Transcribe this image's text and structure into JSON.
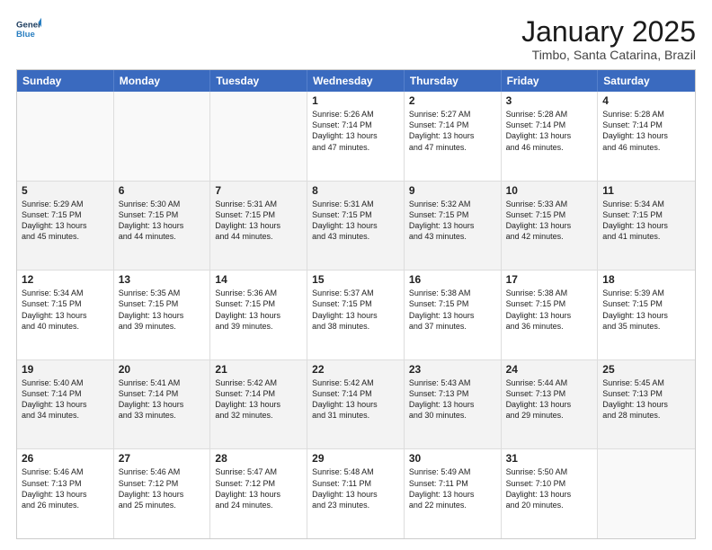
{
  "logo": {
    "line1": "General",
    "line2": "Blue"
  },
  "title": "January 2025",
  "subtitle": "Timbo, Santa Catarina, Brazil",
  "days_of_week": [
    "Sunday",
    "Monday",
    "Tuesday",
    "Wednesday",
    "Thursday",
    "Friday",
    "Saturday"
  ],
  "weeks": [
    {
      "shade": false,
      "cells": [
        {
          "day": "",
          "empty": true,
          "lines": []
        },
        {
          "day": "",
          "empty": true,
          "lines": []
        },
        {
          "day": "",
          "empty": true,
          "lines": []
        },
        {
          "day": "1",
          "empty": false,
          "lines": [
            "Sunrise: 5:26 AM",
            "Sunset: 7:14 PM",
            "Daylight: 13 hours",
            "and 47 minutes."
          ]
        },
        {
          "day": "2",
          "empty": false,
          "lines": [
            "Sunrise: 5:27 AM",
            "Sunset: 7:14 PM",
            "Daylight: 13 hours",
            "and 47 minutes."
          ]
        },
        {
          "day": "3",
          "empty": false,
          "lines": [
            "Sunrise: 5:28 AM",
            "Sunset: 7:14 PM",
            "Daylight: 13 hours",
            "and 46 minutes."
          ]
        },
        {
          "day": "4",
          "empty": false,
          "lines": [
            "Sunrise: 5:28 AM",
            "Sunset: 7:14 PM",
            "Daylight: 13 hours",
            "and 46 minutes."
          ]
        }
      ]
    },
    {
      "shade": true,
      "cells": [
        {
          "day": "5",
          "empty": false,
          "lines": [
            "Sunrise: 5:29 AM",
            "Sunset: 7:15 PM",
            "Daylight: 13 hours",
            "and 45 minutes."
          ]
        },
        {
          "day": "6",
          "empty": false,
          "lines": [
            "Sunrise: 5:30 AM",
            "Sunset: 7:15 PM",
            "Daylight: 13 hours",
            "and 44 minutes."
          ]
        },
        {
          "day": "7",
          "empty": false,
          "lines": [
            "Sunrise: 5:31 AM",
            "Sunset: 7:15 PM",
            "Daylight: 13 hours",
            "and 44 minutes."
          ]
        },
        {
          "day": "8",
          "empty": false,
          "lines": [
            "Sunrise: 5:31 AM",
            "Sunset: 7:15 PM",
            "Daylight: 13 hours",
            "and 43 minutes."
          ]
        },
        {
          "day": "9",
          "empty": false,
          "lines": [
            "Sunrise: 5:32 AM",
            "Sunset: 7:15 PM",
            "Daylight: 13 hours",
            "and 43 minutes."
          ]
        },
        {
          "day": "10",
          "empty": false,
          "lines": [
            "Sunrise: 5:33 AM",
            "Sunset: 7:15 PM",
            "Daylight: 13 hours",
            "and 42 minutes."
          ]
        },
        {
          "day": "11",
          "empty": false,
          "lines": [
            "Sunrise: 5:34 AM",
            "Sunset: 7:15 PM",
            "Daylight: 13 hours",
            "and 41 minutes."
          ]
        }
      ]
    },
    {
      "shade": false,
      "cells": [
        {
          "day": "12",
          "empty": false,
          "lines": [
            "Sunrise: 5:34 AM",
            "Sunset: 7:15 PM",
            "Daylight: 13 hours",
            "and 40 minutes."
          ]
        },
        {
          "day": "13",
          "empty": false,
          "lines": [
            "Sunrise: 5:35 AM",
            "Sunset: 7:15 PM",
            "Daylight: 13 hours",
            "and 39 minutes."
          ]
        },
        {
          "day": "14",
          "empty": false,
          "lines": [
            "Sunrise: 5:36 AM",
            "Sunset: 7:15 PM",
            "Daylight: 13 hours",
            "and 39 minutes."
          ]
        },
        {
          "day": "15",
          "empty": false,
          "lines": [
            "Sunrise: 5:37 AM",
            "Sunset: 7:15 PM",
            "Daylight: 13 hours",
            "and 38 minutes."
          ]
        },
        {
          "day": "16",
          "empty": false,
          "lines": [
            "Sunrise: 5:38 AM",
            "Sunset: 7:15 PM",
            "Daylight: 13 hours",
            "and 37 minutes."
          ]
        },
        {
          "day": "17",
          "empty": false,
          "lines": [
            "Sunrise: 5:38 AM",
            "Sunset: 7:15 PM",
            "Daylight: 13 hours",
            "and 36 minutes."
          ]
        },
        {
          "day": "18",
          "empty": false,
          "lines": [
            "Sunrise: 5:39 AM",
            "Sunset: 7:15 PM",
            "Daylight: 13 hours",
            "and 35 minutes."
          ]
        }
      ]
    },
    {
      "shade": true,
      "cells": [
        {
          "day": "19",
          "empty": false,
          "lines": [
            "Sunrise: 5:40 AM",
            "Sunset: 7:14 PM",
            "Daylight: 13 hours",
            "and 34 minutes."
          ]
        },
        {
          "day": "20",
          "empty": false,
          "lines": [
            "Sunrise: 5:41 AM",
            "Sunset: 7:14 PM",
            "Daylight: 13 hours",
            "and 33 minutes."
          ]
        },
        {
          "day": "21",
          "empty": false,
          "lines": [
            "Sunrise: 5:42 AM",
            "Sunset: 7:14 PM",
            "Daylight: 13 hours",
            "and 32 minutes."
          ]
        },
        {
          "day": "22",
          "empty": false,
          "lines": [
            "Sunrise: 5:42 AM",
            "Sunset: 7:14 PM",
            "Daylight: 13 hours",
            "and 31 minutes."
          ]
        },
        {
          "day": "23",
          "empty": false,
          "lines": [
            "Sunrise: 5:43 AM",
            "Sunset: 7:13 PM",
            "Daylight: 13 hours",
            "and 30 minutes."
          ]
        },
        {
          "day": "24",
          "empty": false,
          "lines": [
            "Sunrise: 5:44 AM",
            "Sunset: 7:13 PM",
            "Daylight: 13 hours",
            "and 29 minutes."
          ]
        },
        {
          "day": "25",
          "empty": false,
          "lines": [
            "Sunrise: 5:45 AM",
            "Sunset: 7:13 PM",
            "Daylight: 13 hours",
            "and 28 minutes."
          ]
        }
      ]
    },
    {
      "shade": false,
      "cells": [
        {
          "day": "26",
          "empty": false,
          "lines": [
            "Sunrise: 5:46 AM",
            "Sunset: 7:13 PM",
            "Daylight: 13 hours",
            "and 26 minutes."
          ]
        },
        {
          "day": "27",
          "empty": false,
          "lines": [
            "Sunrise: 5:46 AM",
            "Sunset: 7:12 PM",
            "Daylight: 13 hours",
            "and 25 minutes."
          ]
        },
        {
          "day": "28",
          "empty": false,
          "lines": [
            "Sunrise: 5:47 AM",
            "Sunset: 7:12 PM",
            "Daylight: 13 hours",
            "and 24 minutes."
          ]
        },
        {
          "day": "29",
          "empty": false,
          "lines": [
            "Sunrise: 5:48 AM",
            "Sunset: 7:11 PM",
            "Daylight: 13 hours",
            "and 23 minutes."
          ]
        },
        {
          "day": "30",
          "empty": false,
          "lines": [
            "Sunrise: 5:49 AM",
            "Sunset: 7:11 PM",
            "Daylight: 13 hours",
            "and 22 minutes."
          ]
        },
        {
          "day": "31",
          "empty": false,
          "lines": [
            "Sunrise: 5:50 AM",
            "Sunset: 7:10 PM",
            "Daylight: 13 hours",
            "and 20 minutes."
          ]
        },
        {
          "day": "",
          "empty": true,
          "lines": []
        }
      ]
    }
  ]
}
